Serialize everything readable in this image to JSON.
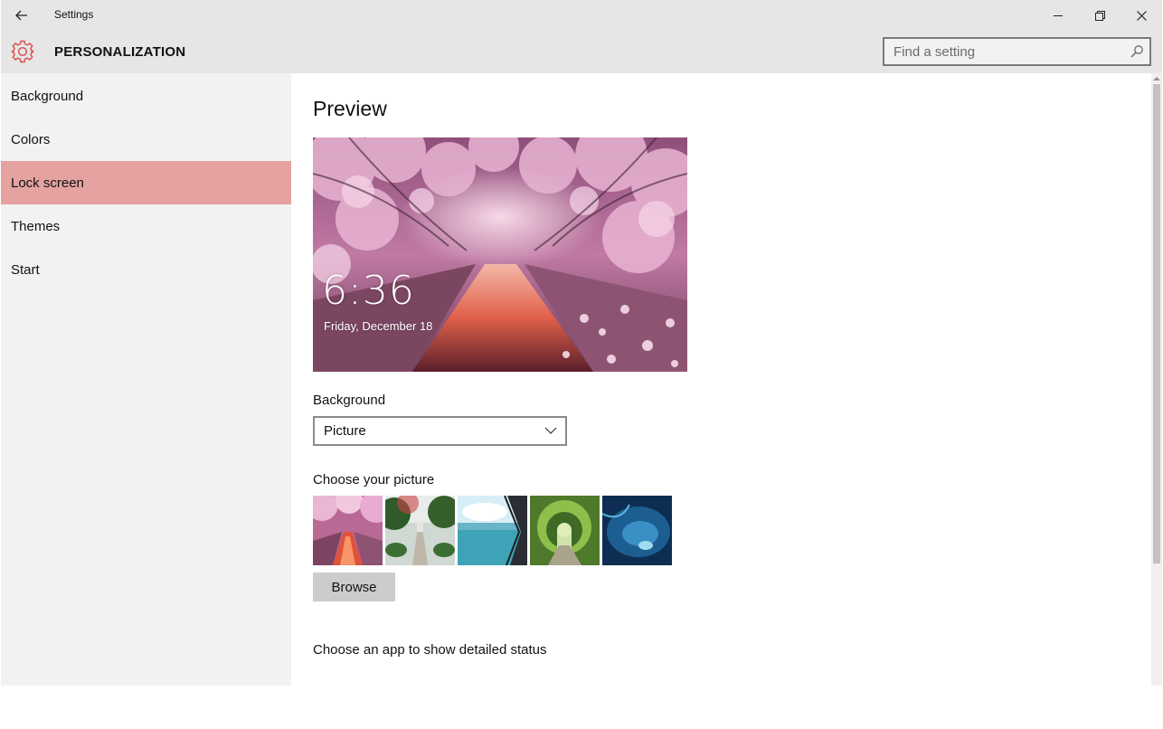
{
  "window": {
    "app_title": "Settings"
  },
  "header": {
    "title": "PERSONALIZATION",
    "icon": "gear-icon",
    "accent_color": "#d9534f"
  },
  "search": {
    "placeholder": "Find a setting",
    "value": ""
  },
  "sidebar": {
    "items": [
      {
        "label": "Background",
        "selected": false
      },
      {
        "label": "Colors",
        "selected": false
      },
      {
        "label": "Lock screen",
        "selected": true
      },
      {
        "label": "Themes",
        "selected": false
      },
      {
        "label": "Start",
        "selected": false
      }
    ],
    "selected_color": "#e4a3a1"
  },
  "content": {
    "section_title": "Preview",
    "preview": {
      "time": "6:36",
      "date": "Friday, December 18"
    },
    "background_label": "Background",
    "background_value": "Picture",
    "choose_picture_label": "Choose your picture",
    "pictures": [
      "cherry-blossom-canal",
      "garden-fountain",
      "rocks-and-sea",
      "green-arch-tunnel",
      "underwater-ice-cave"
    ],
    "browse_label": "Browse",
    "status_label": "Choose an app to show detailed status"
  }
}
